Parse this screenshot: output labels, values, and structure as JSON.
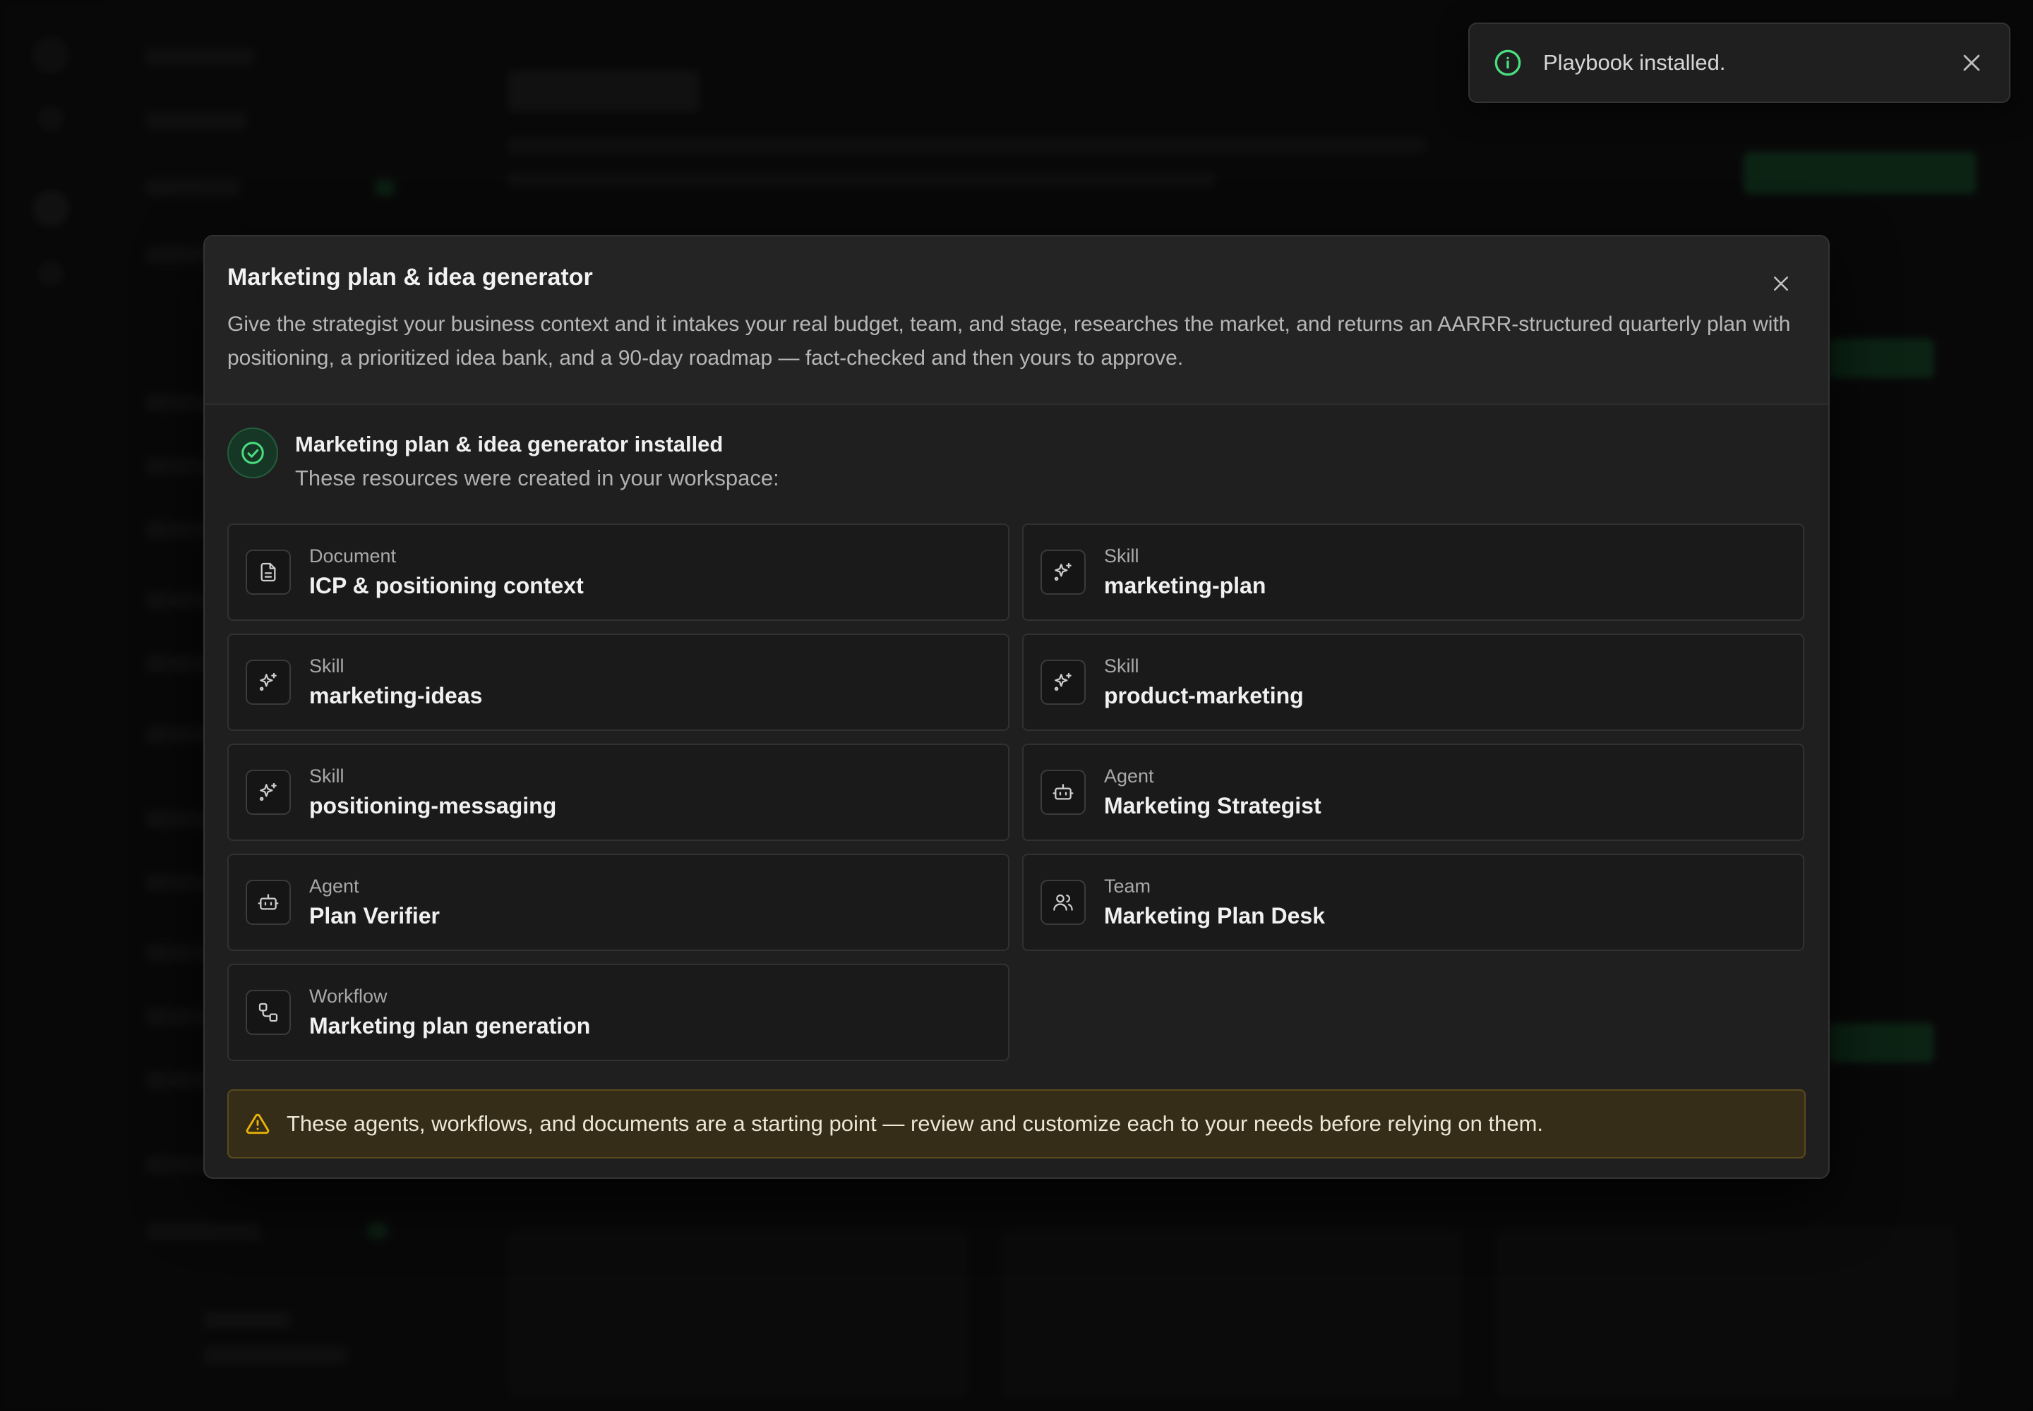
{
  "toast": {
    "message": "Playbook installed.",
    "icon": "info-icon",
    "accent": "#4ade80"
  },
  "modal": {
    "title": "Marketing plan & idea generator",
    "description": "Give the strategist your business context and it intakes your real budget, team, and stage, researches the market, and returns an AARRR-structured quarterly plan with positioning, a prioritized idea bank, and a 90-day roadmap — fact-checked and then yours to approve.",
    "success_title": "Marketing plan & idea generator installed",
    "success_subtitle": "These resources were created in your workspace:",
    "resources": [
      {
        "type": "Document",
        "name": "ICP & positioning context",
        "icon": "document-icon"
      },
      {
        "type": "Skill",
        "name": "marketing-plan",
        "icon": "sparkles-icon"
      },
      {
        "type": "Skill",
        "name": "marketing-ideas",
        "icon": "sparkles-icon"
      },
      {
        "type": "Skill",
        "name": "product-marketing",
        "icon": "sparkles-icon"
      },
      {
        "type": "Skill",
        "name": "positioning-messaging",
        "icon": "sparkles-icon"
      },
      {
        "type": "Agent",
        "name": "Marketing Strategist",
        "icon": "bot-icon"
      },
      {
        "type": "Agent",
        "name": "Plan Verifier",
        "icon": "bot-icon"
      },
      {
        "type": "Team",
        "name": "Marketing Plan Desk",
        "icon": "users-icon"
      },
      {
        "type": "Workflow",
        "name": "Marketing plan generation",
        "icon": "workflow-icon"
      }
    ],
    "warning": "These agents, workflows, and documents are a starting point — review and customize each to your needs before relying on them."
  },
  "colors": {
    "success": "#4ade80",
    "warning": "#eab308",
    "surface": "#1f1f1f"
  }
}
